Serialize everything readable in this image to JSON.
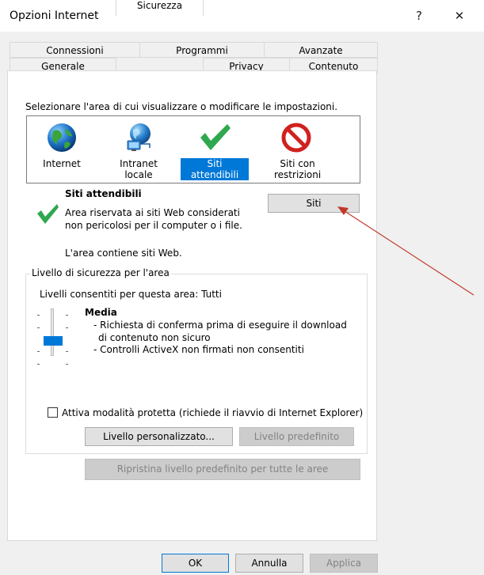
{
  "window": {
    "title": "Opzioni Internet",
    "help_label": "?",
    "close_label": "✕"
  },
  "tabs": {
    "row1": [
      "Connessioni",
      "Programmi",
      "Avanzate"
    ],
    "row2": [
      "Generale",
      "Sicurezza",
      "Privacy",
      "Contenuto"
    ],
    "active": "Sicurezza"
  },
  "security": {
    "instruction": "Selezionare l'area di cui visualizzare o modificare le impostazioni.",
    "zones": [
      {
        "label": "Internet",
        "icon": "globe-icon"
      },
      {
        "label": "Intranet locale",
        "icon": "intranet-globe-icon"
      },
      {
        "label": "Siti attendibili",
        "icon": "green-check-icon",
        "selected": true
      },
      {
        "label": "Siti con restrizioni",
        "icon": "red-no-entry-icon"
      }
    ],
    "zone_title": "Siti attendibili",
    "zone_desc_line1": "Area riservata ai siti Web considerati",
    "zone_desc_line2": "non pericolosi per il computer o i file.",
    "zone_contains": "L'area contiene siti Web.",
    "sites_button": "Siti"
  },
  "level": {
    "group_title": "Livello di sicurezza per l'area",
    "allowed": "Livelli consentiti per questa area: Tutti",
    "level_name": "Media",
    "bullet1_line1": "- Richiesta di conferma prima di eseguire il download",
    "bullet1_line2": "di contenuto non sicuro",
    "bullet2": "- Controlli ActiveX non firmati non consentiti",
    "slider_level": 3,
    "protected_mode": "Attiva modalità protetta (richiede il riavvio di Internet Explorer)",
    "protected_checked": false,
    "custom_button": "Livello personalizzato...",
    "default_button": "Livello predefinito",
    "reset_all_button": "Ripristina livello predefinito per tutte le aree"
  },
  "footer": {
    "ok": "OK",
    "cancel": "Annulla",
    "apply": "Applica"
  },
  "colors": {
    "accent": "#0078d7",
    "annotation_arrow": "#c0392b"
  }
}
